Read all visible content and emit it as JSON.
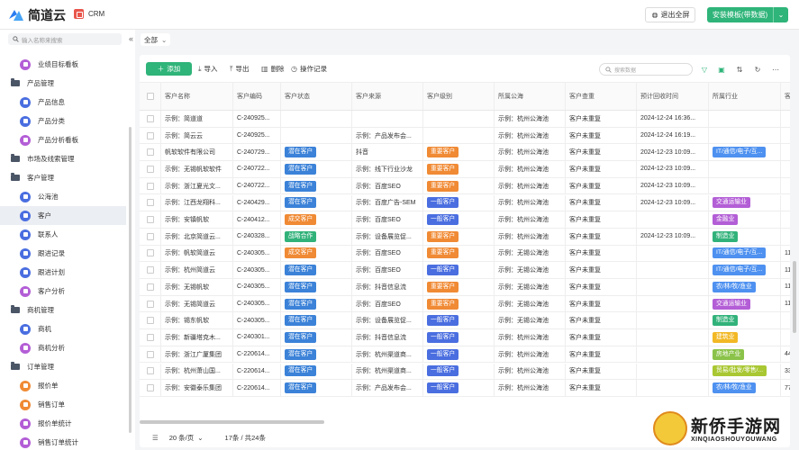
{
  "app": {
    "logo_text": "简道云",
    "tab_name": "CRM"
  },
  "header": {
    "exit_fullscreen": "退出全屏",
    "install_template": "安装模板(带数据)"
  },
  "sidebar": {
    "search_placeholder": "输入名称来搜索",
    "items": [
      {
        "label": "业绩目标看板",
        "type": "sub",
        "color": "#b35ed6"
      },
      {
        "label": "产品管理",
        "type": "group"
      },
      {
        "label": "产品信息",
        "type": "sub",
        "color": "#4a6ee0"
      },
      {
        "label": "产品分类",
        "type": "sub",
        "color": "#4a6ee0"
      },
      {
        "label": "产品分析看板",
        "type": "sub",
        "color": "#b35ed6"
      },
      {
        "label": "市场及线索管理",
        "type": "group"
      },
      {
        "label": "客户管理",
        "type": "group"
      },
      {
        "label": "公海池",
        "type": "sub",
        "color": "#4a6ee0",
        "active": true
      },
      {
        "label": "客户",
        "type": "sub",
        "color": "#4a6ee0",
        "active": true
      },
      {
        "label": "联系人",
        "type": "sub",
        "color": "#4a6ee0"
      },
      {
        "label": "跟进记录",
        "type": "sub",
        "color": "#4a6ee0"
      },
      {
        "label": "跟进计划",
        "type": "sub",
        "color": "#4a6ee0"
      },
      {
        "label": "客户分析",
        "type": "sub",
        "color": "#b35ed6"
      },
      {
        "label": "商机管理",
        "type": "group"
      },
      {
        "label": "商机",
        "type": "sub",
        "color": "#4a6ee0"
      },
      {
        "label": "商机分析",
        "type": "sub",
        "color": "#b35ed6"
      },
      {
        "label": "订单管理",
        "type": "group"
      },
      {
        "label": "报价单",
        "type": "sub",
        "color": "#f08a34"
      },
      {
        "label": "销售订单",
        "type": "sub",
        "color": "#f08a34"
      },
      {
        "label": "报价单统计",
        "type": "sub",
        "color": "#b35ed6"
      },
      {
        "label": "销售订单统计",
        "type": "sub",
        "color": "#b35ed6"
      }
    ]
  },
  "filter": {
    "label": "全部"
  },
  "toolbar": {
    "add": "添加",
    "import": "导入",
    "export": "导出",
    "delete": "删除",
    "log": "操作记录",
    "search_placeholder": "搜索数据"
  },
  "table": {
    "columns": [
      "客户名称",
      "客户编码",
      "客户状态",
      "客户来源",
      "客户级别",
      "所属公海",
      "客户查重",
      "预计回收时间",
      "所属行业",
      "客"
    ],
    "rows": [
      [
        "示例：简道道",
        "C-240925...",
        "",
        "",
        "",
        "示例：杭州公海池",
        "客户未重复",
        "2024-12-24 16:36...",
        "",
        ""
      ],
      [
        "示例：简云云",
        "C-240925...",
        "",
        "示例：产品发布会...",
        "",
        "示例：杭州公海池",
        "客户未重复",
        "2024-12-24 16:19...",
        "",
        ""
      ],
      [
        "帆软软件有限公司",
        "C-240729...",
        "潜在客户",
        "抖音",
        "重要客户",
        "示例：杭州公海池",
        "客户未重复",
        "2024-12-23 10:09...",
        "IT/通信/电子/互...",
        ""
      ],
      [
        "示例：无锡帆软软件",
        "C-240722...",
        "潜在客户",
        "示例：线下行业沙龙",
        "重要客户",
        "示例：杭州公海池",
        "客户未重复",
        "2024-12-23 10:09...",
        "",
        ""
      ],
      [
        "示例：浙江夏光文...",
        "C-240722...",
        "潜在客户",
        "示例：百度SEO",
        "重要客户",
        "示例：杭州公海池",
        "客户未重复",
        "2024-12-23 10:09...",
        "",
        ""
      ],
      [
        "示例：江西龙翔科...",
        "C-240429...",
        "潜在客户",
        "示例：百度广告-SEM",
        "一般客户",
        "示例：杭州公海池",
        "客户未重复",
        "2024-12-23 10:09...",
        "交通运输业",
        ""
      ],
      [
        "示例：安镇帆软",
        "C-240412...",
        "成交客户",
        "示例：百度SEO",
        "一般客户",
        "示例：杭州公海池",
        "客户未重复",
        "",
        "金融业",
        ""
      ],
      [
        "示例：北京简道云...",
        "C-240328...",
        "战略合作",
        "示例：设备展览促...",
        "重要客户",
        "示例：杭州公海池",
        "客户未重复",
        "2024-12-23 10:09...",
        "制造业",
        ""
      ],
      [
        "示例：帆软简道云",
        "C-240305...",
        "成交客户",
        "示例：百度SEO",
        "重要客户",
        "示例：无锡公海池",
        "客户未重复",
        "",
        "IT/通信/电子/互...",
        "113"
      ],
      [
        "示例：杭州简道云",
        "C-240305...",
        "潜在客户",
        "示例：百度SEO",
        "一般客户",
        "示例：无锡公海池",
        "客户未重复",
        "",
        "IT/通信/电子/互...",
        "113"
      ],
      [
        "示例：无锡帆软",
        "C-240305...",
        "潜在客户",
        "示例：抖音信息流",
        "重要客户",
        "示例：无锡公海池",
        "客户未重复",
        "",
        "农/林/牧/渔业",
        "113"
      ],
      [
        "示例：无锡简道云",
        "C-240305...",
        "潜在客户",
        "示例：百度SEO",
        "重要客户",
        "示例：无锡公海池",
        "客户未重复",
        "",
        "交通运输业",
        "113"
      ],
      [
        "示例：锡东帆软",
        "C-240305...",
        "潜在客户",
        "示例：设备展览促...",
        "一般客户",
        "示例：无锡公海池",
        "客户未重复",
        "",
        "制造业",
        ""
      ],
      [
        "示例：新疆塔克木...",
        "C-240301...",
        "潜在客户",
        "示例：抖音信息流",
        "一般客户",
        "示例：杭州公海池",
        "客户未重复",
        "",
        "建筑业",
        ""
      ],
      [
        "示例：浙江广厦集团",
        "C-220614...",
        "潜在客户",
        "示例：杭州渠道商...",
        "一般客户",
        "示例：杭州公海池",
        "客户未重复",
        "",
        "房地产业",
        "444"
      ],
      [
        "示例：杭州萧山国...",
        "C-220614...",
        "潜在客户",
        "示例：杭州渠道商...",
        "一般客户",
        "示例：杭州公海池",
        "客户未重复",
        "",
        "贸易/批发/零售/...",
        "333"
      ],
      [
        "示例：安徽泰乐集团",
        "C-220614...",
        "潜在客户",
        "示例：产品发布会...",
        "一般客户",
        "示例：杭州公海池",
        "客户未重复",
        "",
        "农/林/牧/渔业",
        "777"
      ]
    ]
  },
  "tag_colors": {
    "潜在客户": "t-blue",
    "成交客户": "t-orange",
    "战略合作": "t-green",
    "重要客户": "t-orange",
    "一般客户": "t-indigo",
    "IT/通信/电子/互...": "t-lblue",
    "交通运输业": "t-purple",
    "金融业": "t-purple",
    "制造业": "t-green",
    "农/林/牧/渔业": "t-lblue",
    "建筑业": "t-yellow",
    "房地产业": "t-ygreen",
    "贸易/批发/零售/...": "t-lime"
  },
  "footer": {
    "page_size": "20 条/页",
    "pager": "17条 / 共24条"
  },
  "watermark": {
    "title": "新侨手游网",
    "subtitle": "XINQIAOSHOUYOUWANG"
  }
}
